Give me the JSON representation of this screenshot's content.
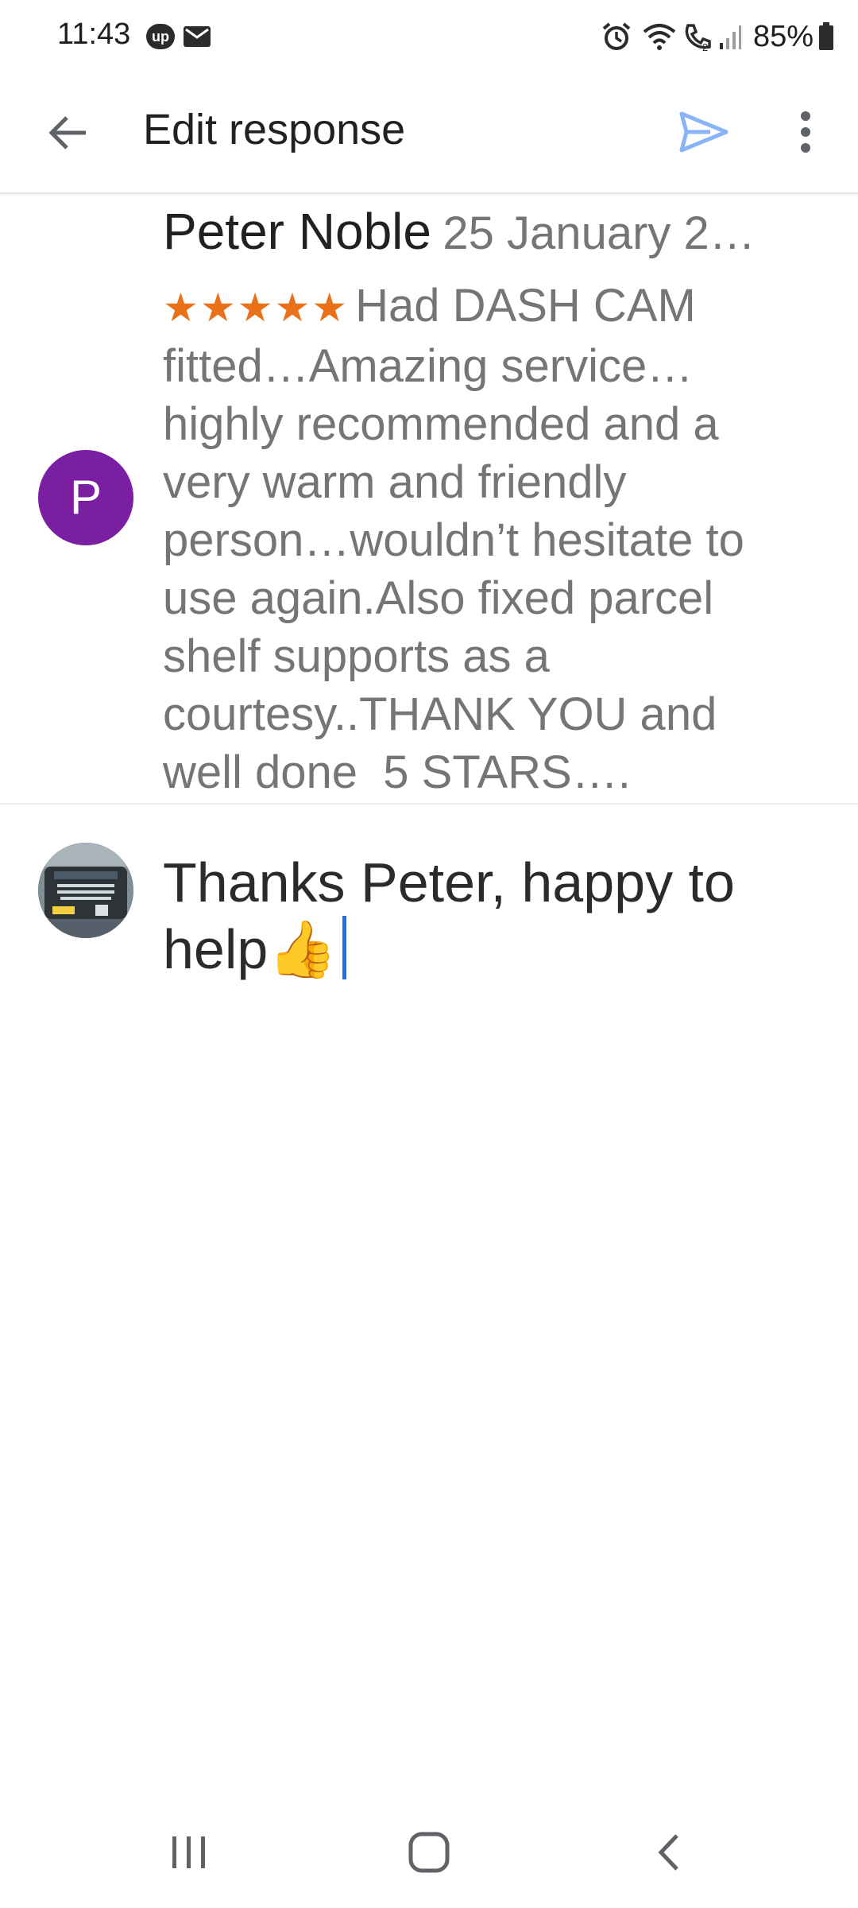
{
  "status_bar": {
    "time": "11:43",
    "badge": "up",
    "battery": "85%",
    "icons": [
      "up-badge-icon",
      "mail-icon",
      "alarm-icon",
      "wifi-icon",
      "wifi-calling-icon",
      "signal-icon",
      "battery-icon"
    ]
  },
  "app_bar": {
    "title": "Edit response",
    "accent_color": "#8ab4f8"
  },
  "review": {
    "avatar_letter": "P",
    "avatar_color": "#7b1fa2",
    "reviewer_name": "Peter Noble",
    "date": "25 January 2…",
    "stars": "★★★★★",
    "rating": 5,
    "star_color": "#e8711a",
    "text": "Had DASH CAM fitted…Amazing service…highly recommended and a  very warm and friendly person…wouldn’t hesitate to use again.Also fixed parcel shelf supports as a courtesy..THANK YOU and well done  5 STARS…."
  },
  "response": {
    "text": "Thanks Peter, happy to help👍",
    "caret_color": "#1a73e8"
  },
  "nav_bar": {
    "icons": [
      "recent-apps-icon",
      "home-icon",
      "back-icon"
    ]
  }
}
